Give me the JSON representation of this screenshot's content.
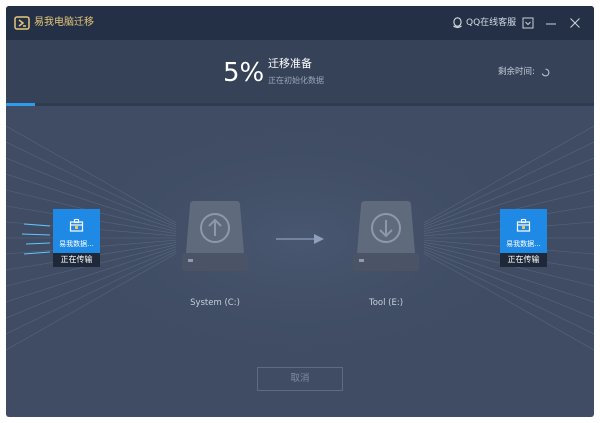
{
  "window": {
    "title": "易我电脑迁移",
    "support_label": "QQ在线客服",
    "icons": {
      "logo": "app-logo-icon",
      "support": "qq-penguin-icon",
      "menu": "dropdown-menu-icon",
      "minimize": "minimize-icon",
      "close": "close-icon"
    }
  },
  "progress": {
    "percent_text": "5%",
    "percent": 5,
    "title": "迁移准备",
    "subtitle": "正在初始化数据",
    "remaining_label": "剩余时间:"
  },
  "transfer": {
    "source_tile": {
      "name": "易我数据...",
      "status": "正在传输",
      "icon": "transfer-package-icon"
    },
    "target_tile": {
      "name": "易我数据...",
      "status": "正在传输",
      "icon": "transfer-package-icon"
    },
    "source_drive": {
      "label": "System (C:)",
      "icon": "upload-arrow-icon"
    },
    "target_drive": {
      "label": "Tool (E:)",
      "icon": "download-arrow-icon"
    },
    "arrow_icon": "right-arrow-icon"
  },
  "actions": {
    "cancel_label": "取消"
  },
  "colors": {
    "accent": "#2d9cf0",
    "title_gold": "#e6c77a",
    "tile_blue": "#1f8ae6",
    "background": "#3f4c63"
  }
}
